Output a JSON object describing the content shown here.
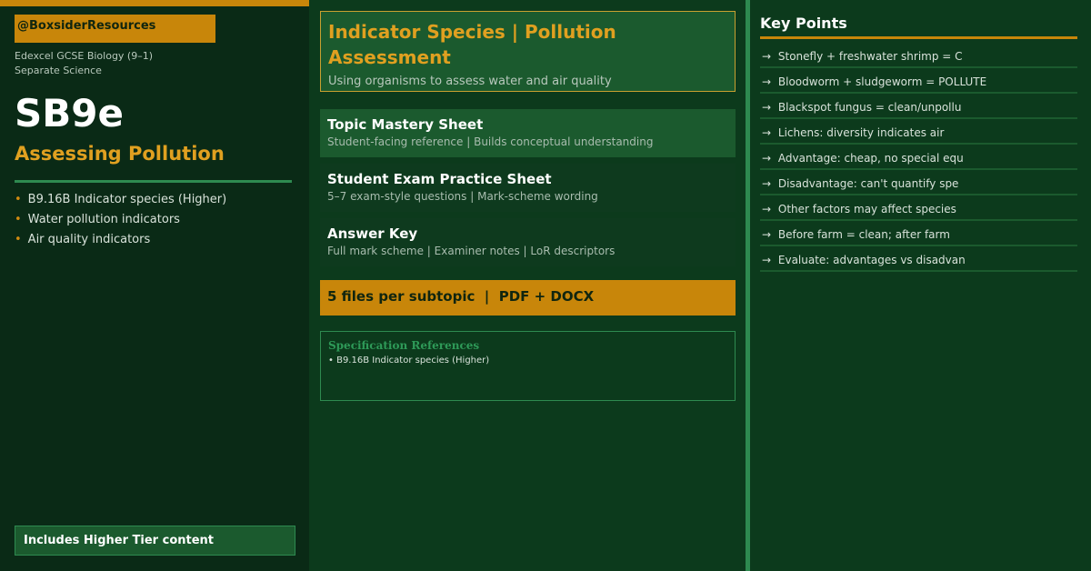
{
  "left": {
    "handle": "@BoxsiderResources",
    "course_line1": "Edexcel GCSE Biology (9–1)",
    "course_line2": "Separate Science",
    "code": "SB9e",
    "subtitle": "Assessing Pollution",
    "bullets": [
      "B9.16B Indicator species (Higher)",
      "Water pollution indicators",
      "Air quality indicators"
    ],
    "tier_note": "Includes Higher Tier content"
  },
  "header": {
    "title": "Indicator Species | Pollution Assessment",
    "description": "Using organisms to assess water and air quality"
  },
  "cards": [
    {
      "title": "Topic Mastery Sheet",
      "description": "Student-facing reference | Builds conceptual understanding"
    },
    {
      "title": "Student Exam Practice Sheet",
      "description": "5–7 exam-style questions | Mark-scheme wording"
    },
    {
      "title": "Answer Key",
      "description": "Full mark scheme | Examiner notes | LoR descriptors"
    }
  ],
  "files_bar": "5 files per subtopic  |  PDF + DOCX",
  "spec": {
    "title": "Specification References",
    "item": "• B9.16B Indicator species (Higher)"
  },
  "key_points": {
    "title": "Key Points",
    "items": [
      "Stonefly + freshwater shrimp = C",
      "Bloodworm + sludgeworm = POLLUTE",
      "Blackspot fungus = clean/unpollu",
      "Lichens: diversity indicates air",
      "Advantage: cheap, no special equ",
      "Disadvantage: can't quantify spe",
      "Other factors may affect species",
      "Before farm = clean; after farm",
      "Evaluate: advantages vs disadvan"
    ]
  },
  "glyphs": {
    "bullet": "•",
    "arrow": "→"
  },
  "colors": {
    "accent": "#c8860a",
    "green": "#2e8a50",
    "bg": "#0c3a1c"
  }
}
